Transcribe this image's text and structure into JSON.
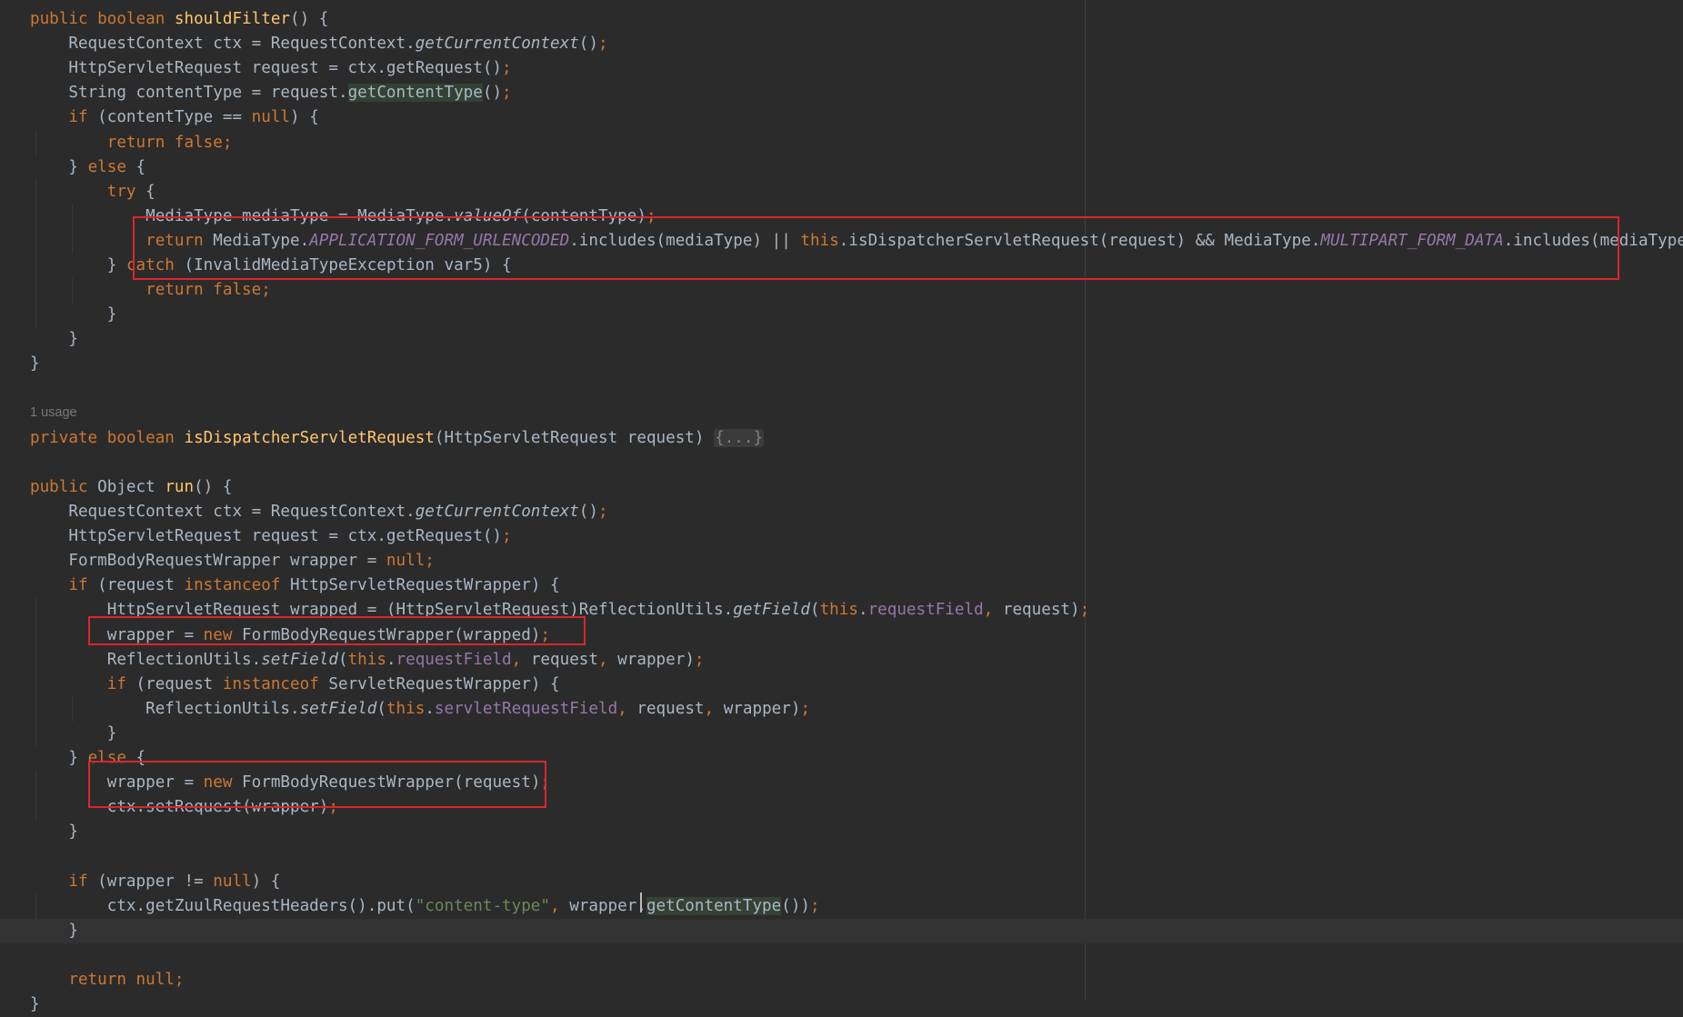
{
  "editor": {
    "usage_hint": "1 usage",
    "lines": [
      [
        [
          "kw",
          "public "
        ],
        [
          "kw",
          "boolean "
        ],
        [
          "fn",
          "shouldFilter"
        ],
        [
          "t",
          "() {"
        ]
      ],
      [
        [
          "t",
          "    RequestContext ctx = RequestContext."
        ],
        [
          "it",
          "getCurrentContext"
        ],
        [
          "t",
          "()"
        ],
        [
          "semi",
          ";"
        ]
      ],
      [
        [
          "t",
          "    HttpServletRequest request = ctx.getRequest()"
        ],
        [
          "semi",
          ";"
        ]
      ],
      [
        [
          "t",
          "    String contentType = request."
        ],
        [
          "usagehl",
          "getContentType"
        ],
        [
          "t",
          "()"
        ],
        [
          "semi",
          ";"
        ]
      ],
      [
        [
          "kw",
          "    if "
        ],
        [
          "t",
          "(contentType == "
        ],
        [
          "kw",
          "null"
        ],
        [
          "t",
          ") {"
        ]
      ],
      [
        [
          "kw",
          "        return false"
        ],
        [
          "semi",
          ";"
        ]
      ],
      [
        [
          "t",
          "    } "
        ],
        [
          "kw",
          "else "
        ],
        [
          "t",
          "{"
        ]
      ],
      [
        [
          "kw",
          "        try "
        ],
        [
          "t",
          "{"
        ]
      ],
      [
        [
          "t",
          "            MediaType mediaType = MediaType."
        ],
        [
          "it",
          "valueOf"
        ],
        [
          "t",
          "(contentType)"
        ],
        [
          "semi",
          ";"
        ]
      ],
      [
        [
          "kw",
          "            return "
        ],
        [
          "t",
          "MediaType."
        ],
        [
          "cst",
          "APPLICATION_FORM_URLENCODED"
        ],
        [
          "t",
          ".includes(mediaType) || "
        ],
        [
          "kw",
          "this"
        ],
        [
          "t",
          ".isDispatcherServletRequest(request) && MediaType."
        ],
        [
          "cst",
          "MULTIPART_FORM_DATA"
        ],
        [
          "t",
          ".includes(mediaType)"
        ],
        [
          "semi",
          ";"
        ]
      ],
      [
        [
          "t",
          "        } "
        ],
        [
          "kw",
          "catch "
        ],
        [
          "t",
          "(InvalidMediaTypeException var5) {"
        ]
      ],
      [
        [
          "kw",
          "            return false"
        ],
        [
          "semi",
          ";"
        ]
      ],
      [
        [
          "t",
          "        }"
        ]
      ],
      [
        [
          "t",
          "    }"
        ]
      ],
      [
        [
          "t",
          "}"
        ]
      ],
      [],
      [],
      [
        [
          "kw",
          "private "
        ],
        [
          "kw",
          "boolean "
        ],
        [
          "fn",
          "isDispatcherServletRequest"
        ],
        [
          "t",
          "(HttpServletRequest request) "
        ],
        [
          "fold",
          "{...}"
        ]
      ],
      [],
      [
        [
          "kw",
          "public "
        ],
        [
          "t",
          "Object "
        ],
        [
          "fn",
          "run"
        ],
        [
          "t",
          "() {"
        ]
      ],
      [
        [
          "t",
          "    RequestContext ctx = RequestContext."
        ],
        [
          "it",
          "getCurrentContext"
        ],
        [
          "t",
          "()"
        ],
        [
          "semi",
          ";"
        ]
      ],
      [
        [
          "t",
          "    HttpServletRequest request = ctx.getRequest()"
        ],
        [
          "semi",
          ";"
        ]
      ],
      [
        [
          "t",
          "    FormBodyRequestWrapper wrapper = "
        ],
        [
          "kw",
          "null"
        ],
        [
          "semi",
          ";"
        ]
      ],
      [
        [
          "kw",
          "    if "
        ],
        [
          "t",
          "(request "
        ],
        [
          "kw",
          "instanceof "
        ],
        [
          "t",
          "HttpServletRequestWrapper) {"
        ]
      ],
      [
        [
          "t",
          "        HttpServletRequest wrapped = (HttpServletRequest)ReflectionUtils."
        ],
        [
          "it",
          "getField"
        ],
        [
          "t",
          "("
        ],
        [
          "kw",
          "this"
        ],
        [
          "t",
          "."
        ],
        [
          "fld",
          "requestField"
        ],
        [
          "semi",
          ", "
        ],
        [
          "t",
          "request)"
        ],
        [
          "semi",
          ";"
        ]
      ],
      [
        [
          "t",
          "        wrapper = "
        ],
        [
          "kw",
          "new "
        ],
        [
          "t",
          "FormBodyRequestWrapper(wrapped)"
        ],
        [
          "semi",
          ";"
        ]
      ],
      [
        [
          "t",
          "        ReflectionUtils."
        ],
        [
          "it",
          "setField"
        ],
        [
          "t",
          "("
        ],
        [
          "kw",
          "this"
        ],
        [
          "t",
          "."
        ],
        [
          "fld",
          "requestField"
        ],
        [
          "semi",
          ", "
        ],
        [
          "t",
          "request"
        ],
        [
          "semi",
          ", "
        ],
        [
          "t",
          "wrapper)"
        ],
        [
          "semi",
          ";"
        ]
      ],
      [
        [
          "kw",
          "        if "
        ],
        [
          "t",
          "(request "
        ],
        [
          "kw",
          "instanceof "
        ],
        [
          "t",
          "ServletRequestWrapper) {"
        ]
      ],
      [
        [
          "t",
          "            ReflectionUtils."
        ],
        [
          "it",
          "setField"
        ],
        [
          "t",
          "("
        ],
        [
          "kw",
          "this"
        ],
        [
          "t",
          "."
        ],
        [
          "fld",
          "servletRequestField"
        ],
        [
          "semi",
          ", "
        ],
        [
          "t",
          "request"
        ],
        [
          "semi",
          ", "
        ],
        [
          "t",
          "wrapper)"
        ],
        [
          "semi",
          ";"
        ]
      ],
      [
        [
          "t",
          "        }"
        ]
      ],
      [
        [
          "t",
          "    } "
        ],
        [
          "kw",
          "else "
        ],
        [
          "t",
          "{"
        ]
      ],
      [
        [
          "t",
          "        wrapper = "
        ],
        [
          "kw",
          "new "
        ],
        [
          "t",
          "FormBodyRequestWrapper(request)"
        ],
        [
          "semi",
          ";"
        ]
      ],
      [
        [
          "t",
          "        ctx.setRequest(wrapper)"
        ],
        [
          "semi",
          ";"
        ]
      ],
      [
        [
          "t",
          "    }"
        ]
      ],
      [],
      [
        [
          "kw",
          "    if "
        ],
        [
          "t",
          "(wrapper != "
        ],
        [
          "kw",
          "null"
        ],
        [
          "t",
          ") {"
        ]
      ],
      [
        [
          "t",
          "        ctx.getZuulRequestHeaders().put("
        ],
        [
          "str",
          "\"content-type\""
        ],
        [
          "semi",
          ", "
        ],
        [
          "t",
          "wrapper."
        ],
        [
          "usagehl",
          "getContentType"
        ],
        [
          "t",
          "())"
        ],
        [
          "semi",
          ";"
        ]
      ],
      [
        [
          "t",
          "    }"
        ]
      ],
      [],
      [
        [
          "kw",
          "    return null"
        ],
        [
          "semi",
          ";"
        ]
      ],
      [
        [
          "t",
          "}"
        ]
      ]
    ]
  }
}
